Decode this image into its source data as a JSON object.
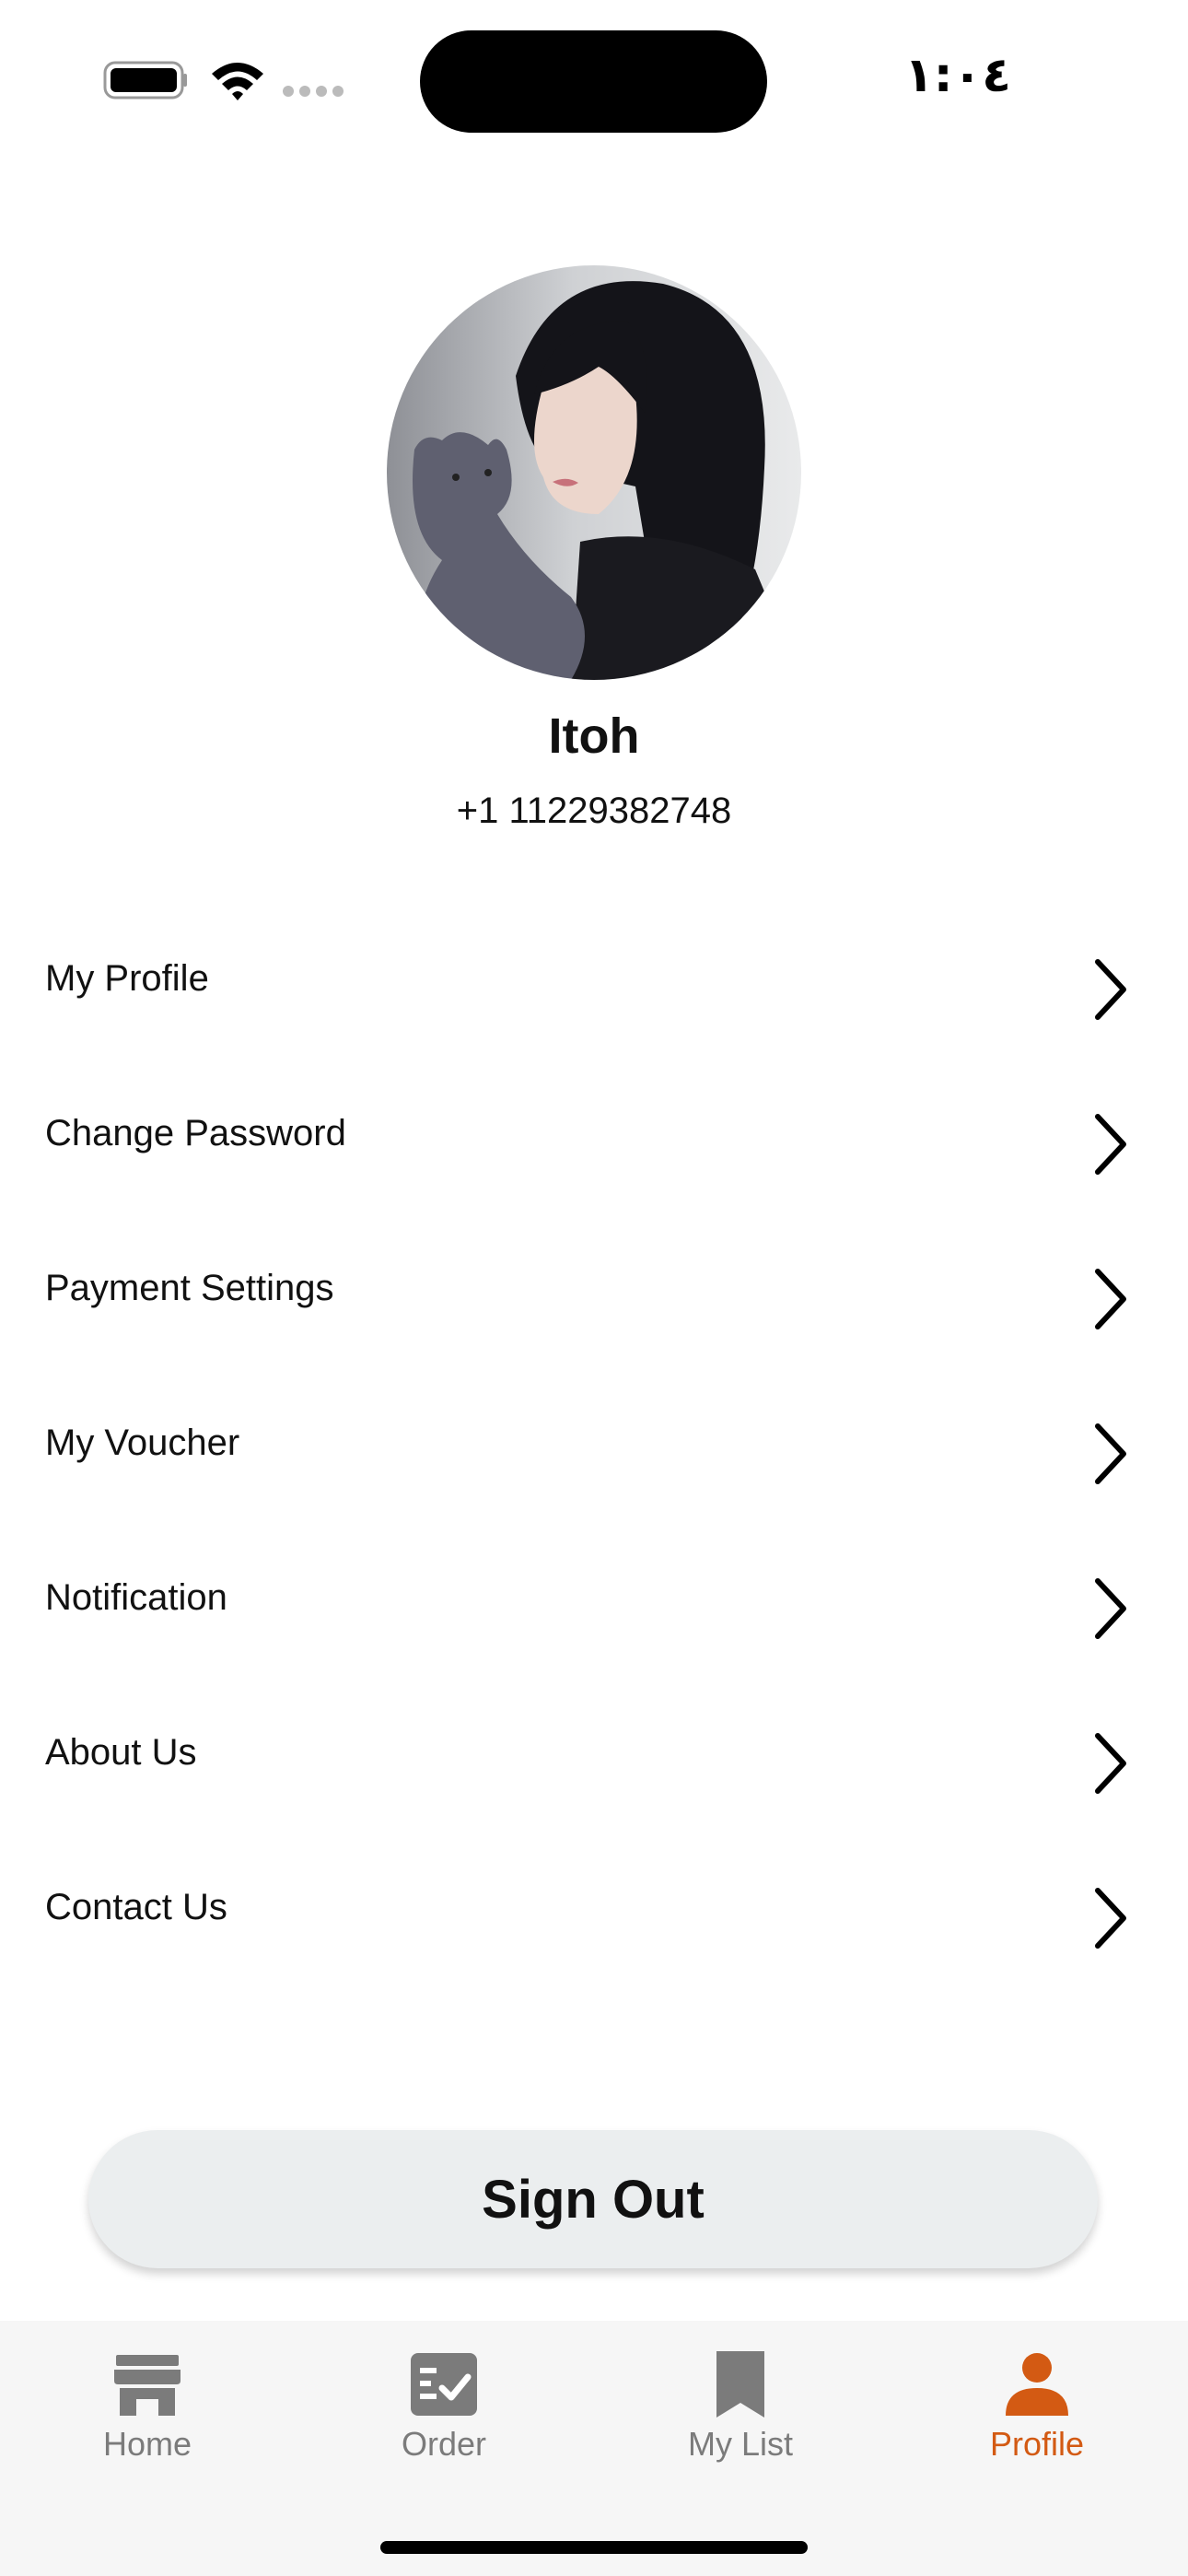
{
  "status_bar": {
    "time": "١:٠٤"
  },
  "profile": {
    "name": "Itoh",
    "phone": "+1 11229382748"
  },
  "menu": [
    {
      "label": "My Profile"
    },
    {
      "label": "Change Password"
    },
    {
      "label": "Payment Settings"
    },
    {
      "label": "My Voucher"
    },
    {
      "label": "Notification"
    },
    {
      "label": "About Us"
    },
    {
      "label": "Contact Us"
    }
  ],
  "sign_out": {
    "label": "Sign Out"
  },
  "tab_bar": {
    "active": "Profile",
    "active_color": "#d35a13",
    "inactive_color": "#7b7b7b",
    "tabs": [
      {
        "label": "Home",
        "icon": "store-icon"
      },
      {
        "label": "Order",
        "icon": "order-list-icon"
      },
      {
        "label": "My List",
        "icon": "bookmark-icon"
      },
      {
        "label": "Profile",
        "icon": "person-icon"
      }
    ]
  }
}
